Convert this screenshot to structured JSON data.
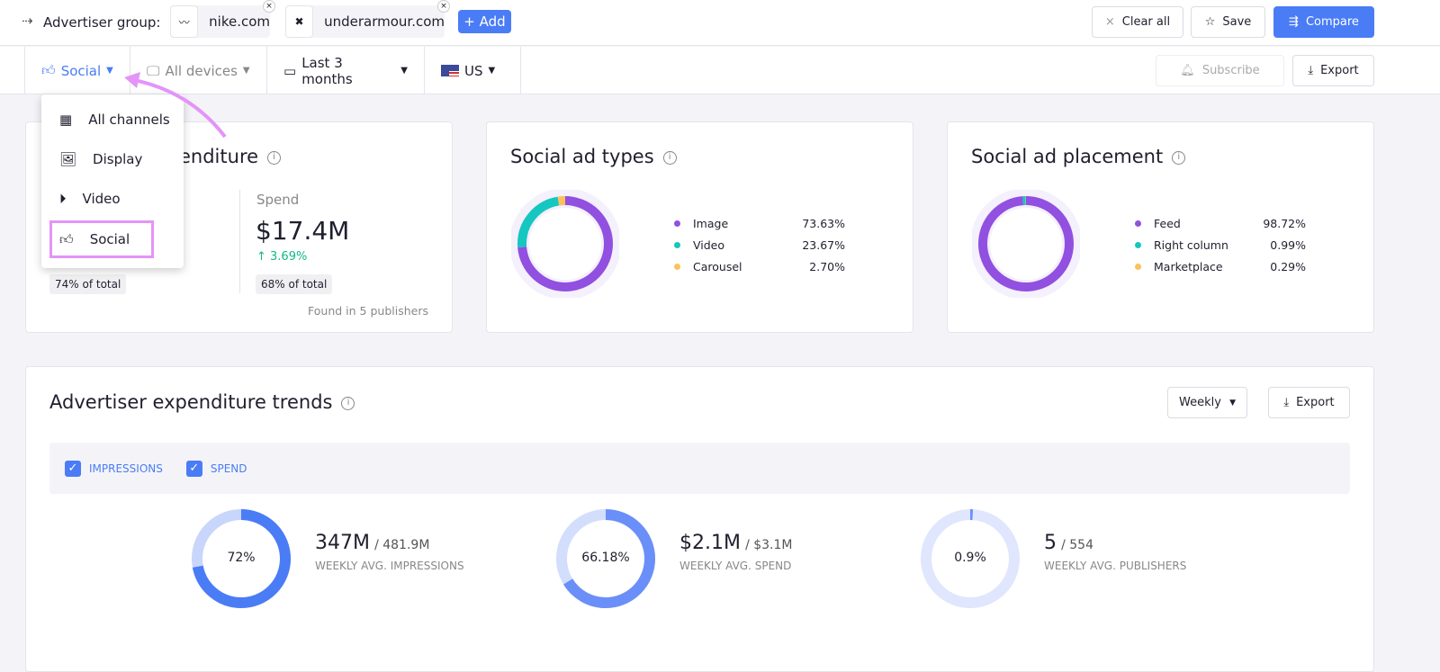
{
  "topbar": {
    "group_label": "Advertiser group:",
    "advertisers": [
      {
        "name": "nike.com",
        "logo": "✓"
      },
      {
        "name": "underarmour.com",
        "logo": "✕"
      }
    ],
    "add_label": "+ Add",
    "clear_label": "Clear all",
    "save_label": "Save",
    "compare_label": "Compare"
  },
  "filters": {
    "channel": "Social",
    "devices": "All devices",
    "period": "Last 3 months",
    "country": "US",
    "subscribe_label": "Subscribe",
    "export_label": "Export"
  },
  "channel_menu": {
    "items": [
      {
        "label": "All channels"
      },
      {
        "label": "Display"
      },
      {
        "label": "Video"
      },
      {
        "label": "Social",
        "selected": true
      }
    ]
  },
  "expenditure": {
    "title_visible": "enditure",
    "spend_label": "Spend",
    "spend_value": "$17.4M",
    "spend_change": "3.69%",
    "left_share": "74% of total",
    "spend_share": "68% of total",
    "publishers_note": "Found in 5 publishers"
  },
  "ad_types": {
    "title": "Social ad types",
    "items": [
      {
        "label": "Image",
        "value": "73.63%",
        "pct": 73.63,
        "color": "#9150e0"
      },
      {
        "label": "Video",
        "value": "23.67%",
        "pct": 23.67,
        "color": "#15c7c0"
      },
      {
        "label": "Carousel",
        "value": "2.70%",
        "pct": 2.7,
        "color": "#fdc15c"
      }
    ]
  },
  "ad_placement": {
    "title": "Social ad placement",
    "items": [
      {
        "label": "Feed",
        "value": "98.72%",
        "pct": 98.72,
        "color": "#9150e0"
      },
      {
        "label": "Right column",
        "value": "0.99%",
        "pct": 0.99,
        "color": "#15c7c0"
      },
      {
        "label": "Marketplace",
        "value": "0.29%",
        "pct": 0.29,
        "color": "#fdc15c"
      }
    ]
  },
  "trends": {
    "title": "Advertiser expenditure trends",
    "interval": "Weekly",
    "export_label": "Export",
    "checkboxes": [
      "IMPRESSIONS",
      "SPEND"
    ],
    "stats": [
      {
        "pct_label": "72%",
        "pct": 72,
        "value": "347M",
        "total": "/ 481.9M",
        "label": "WEEKLY AVG. IMPRESSIONS",
        "color": "#4a7cf6",
        "track": "#c8d6fc"
      },
      {
        "pct_label": "66.18%",
        "pct": 66.18,
        "value": "$2.1M",
        "total": "/ $3.1M",
        "label": "WEEKLY AVG. SPEND",
        "color": "#6b8ff8",
        "track": "#d3defd"
      },
      {
        "pct_label": "0.9%",
        "pct": 0.9,
        "value": "5",
        "total": "/ 554",
        "label": "WEEKLY AVG. PUBLISHERS",
        "color": "#6b8ff8",
        "track": "#dfe6fd"
      }
    ]
  },
  "colors": {
    "accent": "#4a7cf6",
    "highlight": "#e494f8",
    "positive": "#12b886"
  }
}
